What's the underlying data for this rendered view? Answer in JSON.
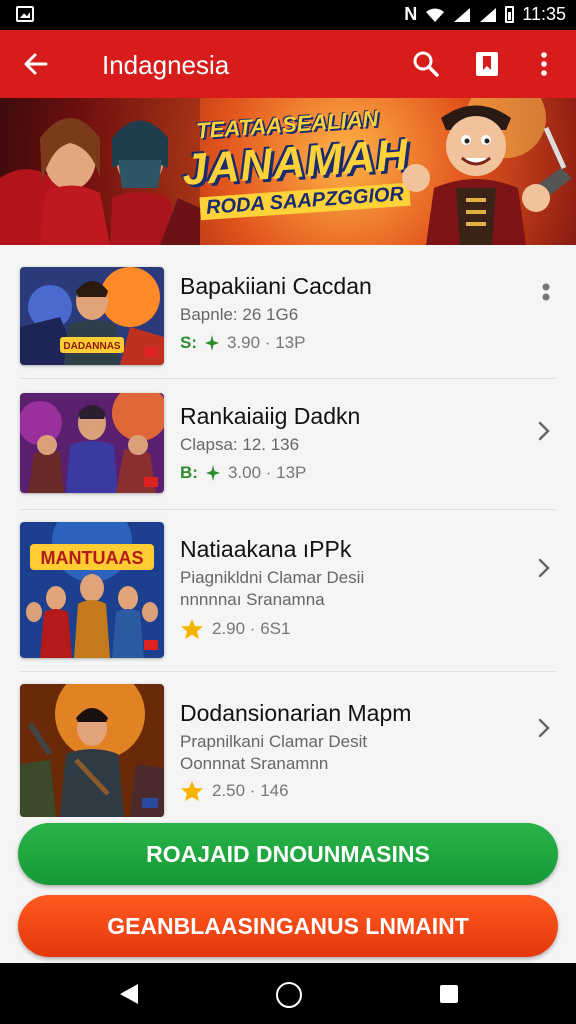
{
  "status_bar": {
    "time": "11:35",
    "icons": [
      "gallery-icon",
      "nfc-icon",
      "wifi-icon",
      "signal-icon",
      "signal-icon",
      "battery-icon"
    ]
  },
  "app_bar": {
    "title": "Indagnesia",
    "icons": [
      "back-arrow-icon",
      "search-icon",
      "bookmark-icon",
      "more-vert-icon"
    ],
    "color": "#d81b1b"
  },
  "banner": {
    "line1": "TEATAASEALIAN",
    "line2": "JANAMAH",
    "line3": "RODA SAAPZGGIOR"
  },
  "list": {
    "items": [
      {
        "title": "Bapakiiani Cacdan",
        "subtitle": "Bapnle: 26 1G6",
        "badge": "S:",
        "meta": "3.90 · 13P",
        "trailing": "more-vert-icon"
      },
      {
        "title": "Rankaiaiig Dadkn",
        "subtitle": "Clapsa: 12. 136",
        "badge": "B:",
        "meta": "3.00 · 13P",
        "trailing": "chevron-right-icon"
      },
      {
        "title": "Natiaakana ıPPk",
        "subtitle": "Piagnikldni Clamar Desii",
        "subtitle2": "nnnnnaı Sranamna",
        "meta": "2.90 · 6S1",
        "trailing": "chevron-right-icon"
      },
      {
        "title": "Dodansionarian Mapm",
        "subtitle": "Prapnilkani Clamar Desit",
        "subtitle2": "Oonnnat Sranamnn",
        "meta": "2.50 · 146",
        "trailing": "chevron-right-icon"
      }
    ],
    "thumb_texts": [
      "DADANNAS",
      "MANTUAAS"
    ]
  },
  "buttons": {
    "primary": "ROAJAID DNOUNMASINS",
    "secondary": "GEANBLAASINGANUS LNMAINT",
    "primary_color": "#1ea83e",
    "secondary_color": "#f2461a"
  },
  "nav_bar": {
    "icons": [
      "nav-back-icon",
      "nav-home-icon",
      "nav-recents-icon"
    ]
  }
}
